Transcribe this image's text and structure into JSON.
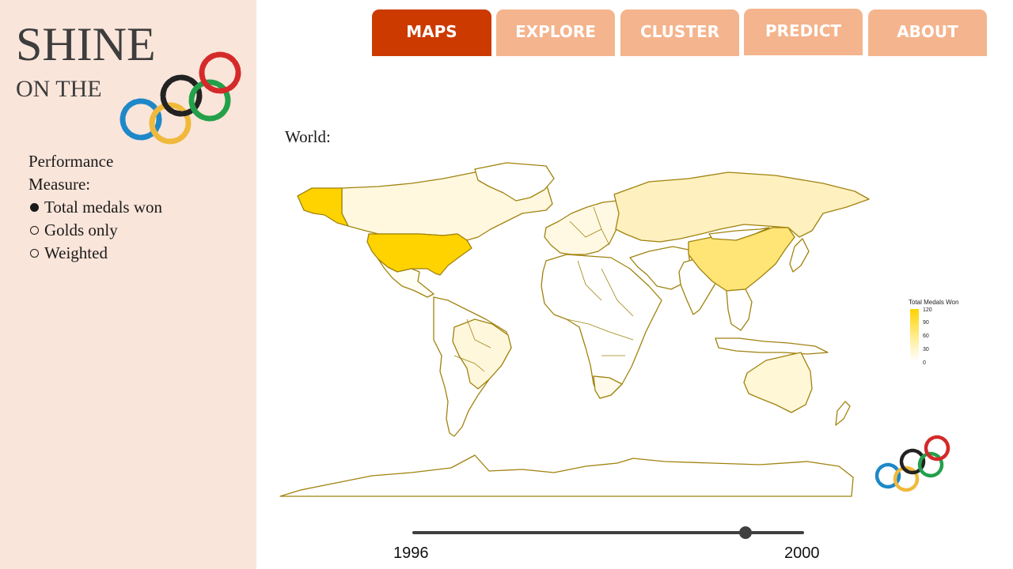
{
  "brand": {
    "line1": "SHINE",
    "line2": "ON THE"
  },
  "measure": {
    "title": "Performance Measure:",
    "options": [
      "Total medals won",
      "Golds only",
      "Weighted"
    ],
    "selected": "Total medals won"
  },
  "tabs": [
    {
      "label": "MAPS",
      "active": true
    },
    {
      "label": "EXPLORE",
      "active": false
    },
    {
      "label": "CLUSTER",
      "active": false
    },
    {
      "label": "PREDICT",
      "active": false
    },
    {
      "label": "ABOUT",
      "active": false
    }
  ],
  "map": {
    "title": "World:",
    "legend_title": "Total Medals Won",
    "legend_ticks": [
      "120",
      "90",
      "60",
      "30",
      "0"
    ],
    "color_scale": {
      "low": "#ffffff",
      "high": "#ffd300"
    },
    "border_color": "#a0820d",
    "highlighted_regions": [
      {
        "region": "United States",
        "level": "high"
      },
      {
        "region": "Alaska",
        "level": "high"
      },
      {
        "region": "China",
        "level": "medium"
      },
      {
        "region": "Russia",
        "level": "low-medium"
      },
      {
        "region": "Australia",
        "level": "low"
      },
      {
        "region": "Canada",
        "level": "low"
      },
      {
        "region": "Brazil",
        "level": "low"
      }
    ]
  },
  "slider": {
    "min_label": "1996",
    "max_label": "2000",
    "value_fraction": 0.85
  },
  "colors": {
    "sidebar_bg": "#fae5da",
    "tab_active": "#cc3a00",
    "tab_inactive": "#f4b48d",
    "ring_blue": "#1e88c8",
    "ring_yellow": "#f0b93c",
    "ring_black": "#222222",
    "ring_green": "#23a04a",
    "ring_red": "#d42a2a"
  }
}
